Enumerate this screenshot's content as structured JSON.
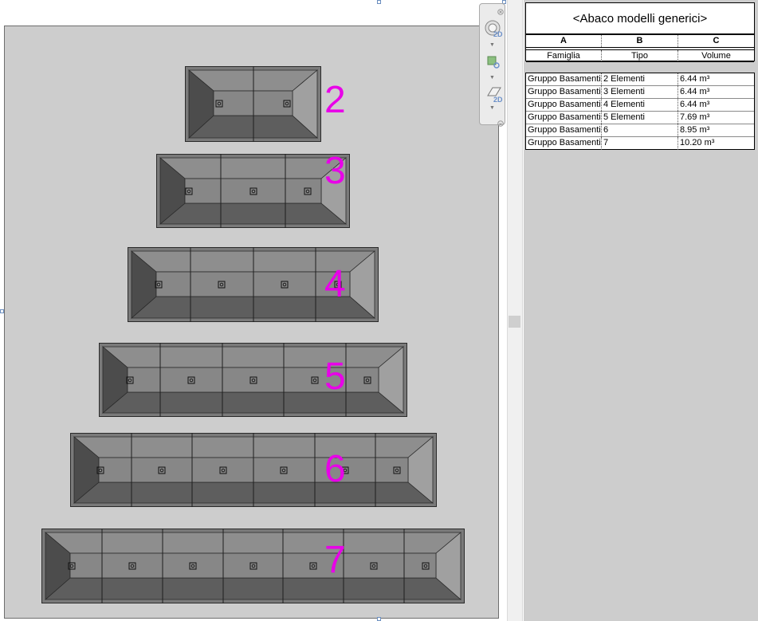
{
  "schedule": {
    "title": "<Abaco modelli generici>",
    "column_letters": [
      "A",
      "B",
      "C"
    ],
    "column_headers": [
      "Famiglia",
      "Tipo",
      "Volume"
    ],
    "rows": [
      {
        "famiglia": "Gruppo Basamenti",
        "tipo": "2 Elementi",
        "volume": "6.44 m³"
      },
      {
        "famiglia": "Gruppo Basamenti",
        "tipo": "3 Elementi",
        "volume": "6.44 m³"
      },
      {
        "famiglia": "Gruppo Basamenti",
        "tipo": "4 Elementi",
        "volume": "6.44 m³"
      },
      {
        "famiglia": "Gruppo Basamenti",
        "tipo": "5 Elementi",
        "volume": "7.69 m³"
      },
      {
        "famiglia": "Gruppo Basamenti",
        "tipo": "6",
        "volume": "8.95 m³"
      },
      {
        "famiglia": "Gruppo Basamenti",
        "tipo": "7",
        "volume": "10.20 m³"
      }
    ]
  },
  "view": {
    "foundations": [
      {
        "label": "2",
        "segments": 2,
        "markers": 2
      },
      {
        "label": "3",
        "segments": 3,
        "markers": 3
      },
      {
        "label": "4",
        "segments": 4,
        "markers": 4
      },
      {
        "label": "5",
        "segments": 5,
        "markers": 5
      },
      {
        "label": "6",
        "segments": 6,
        "markers": 6
      },
      {
        "label": "7",
        "segments": 7,
        "markers": 7
      }
    ],
    "label_color": "#e800e8"
  },
  "navbar": {
    "items": [
      {
        "name": "steering-wheel-icon",
        "badge": "2D"
      },
      {
        "name": "zoom-region-icon"
      },
      {
        "name": "pan-plane-icon",
        "badge": "2D"
      }
    ]
  }
}
